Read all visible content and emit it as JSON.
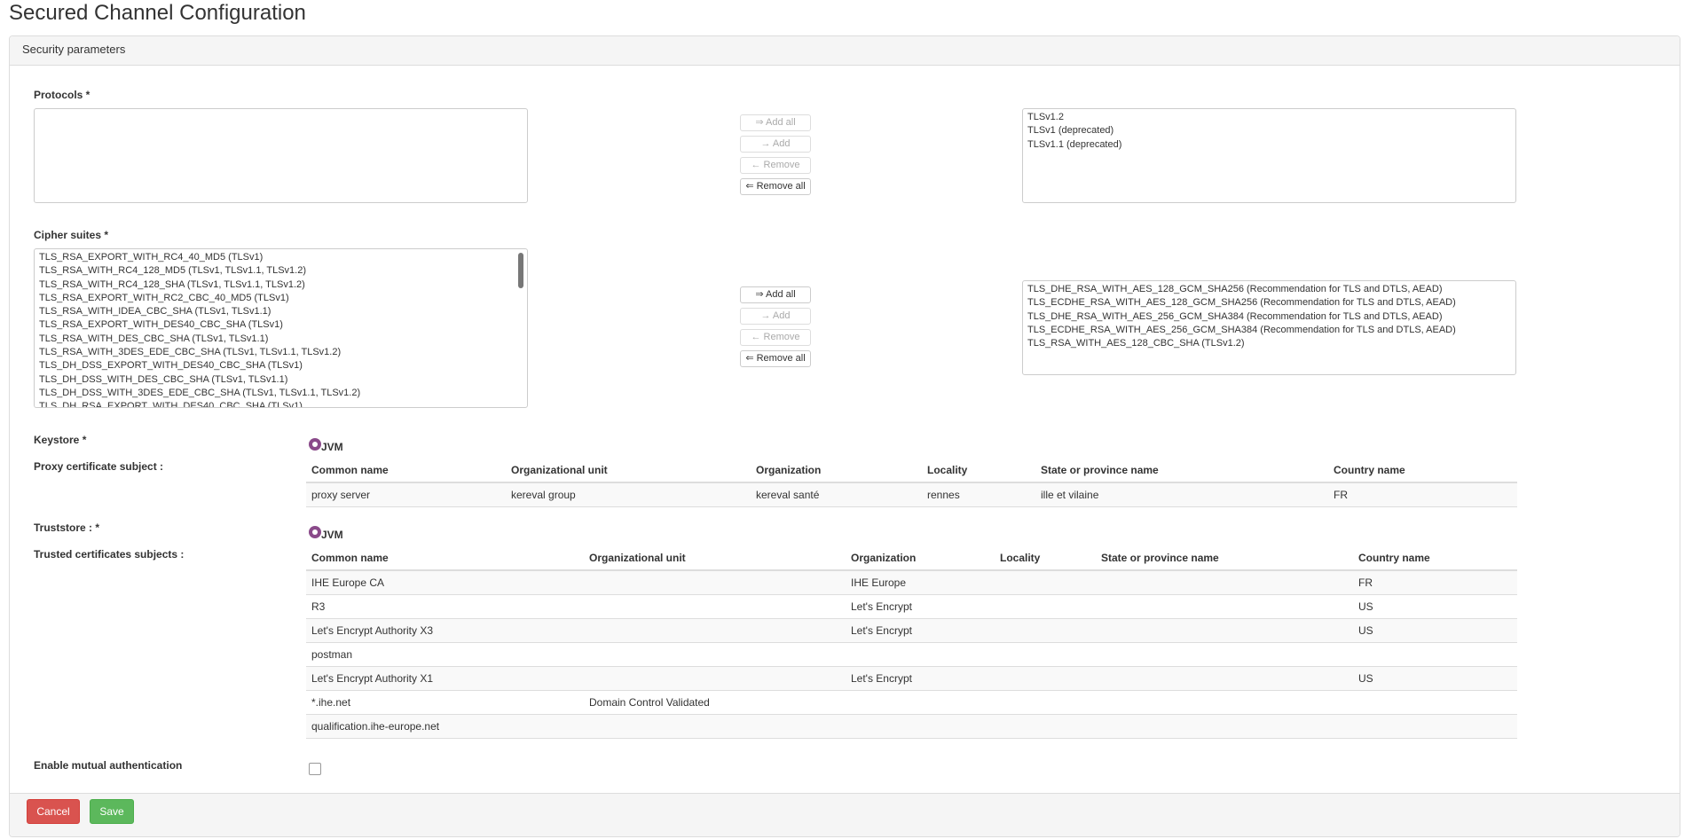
{
  "page": {
    "title": "Secured Channel Configuration"
  },
  "panel": {
    "heading": "Security parameters"
  },
  "protocols": {
    "label": "Protocols *",
    "available": [],
    "selected": [
      "TLSv1.2",
      "TLSv1 (deprecated)",
      "TLSv1.1 (deprecated)"
    ],
    "buttons": {
      "add_all": "⇒ Add all",
      "add": "→ Add",
      "remove": "← Remove",
      "remove_all": "⇐ Remove all"
    }
  },
  "cipher_suites": {
    "label": "Cipher suites *",
    "available": [
      "TLS_RSA_EXPORT_WITH_RC4_40_MD5 (TLSv1)",
      "TLS_RSA_WITH_RC4_128_MD5 (TLSv1, TLSv1.1, TLSv1.2)",
      "TLS_RSA_WITH_RC4_128_SHA (TLSv1, TLSv1.1, TLSv1.2)",
      "TLS_RSA_EXPORT_WITH_RC2_CBC_40_MD5 (TLSv1)",
      "TLS_RSA_WITH_IDEA_CBC_SHA (TLSv1, TLSv1.1)",
      "TLS_RSA_EXPORT_WITH_DES40_CBC_SHA (TLSv1)",
      "TLS_RSA_WITH_DES_CBC_SHA (TLSv1, TLSv1.1)",
      "TLS_RSA_WITH_3DES_EDE_CBC_SHA (TLSv1, TLSv1.1, TLSv1.2)",
      "TLS_DH_DSS_EXPORT_WITH_DES40_CBC_SHA (TLSv1)",
      "TLS_DH_DSS_WITH_DES_CBC_SHA (TLSv1, TLSv1.1)",
      "TLS_DH_DSS_WITH_3DES_EDE_CBC_SHA (TLSv1, TLSv1.1, TLSv1.2)",
      "TLS_DH_RSA_EXPORT_WITH_DES40_CBC_SHA (TLSv1)"
    ],
    "selected": [
      "TLS_DHE_RSA_WITH_AES_128_GCM_SHA256 (Recommendation for TLS and DTLS, AEAD)",
      "TLS_ECDHE_RSA_WITH_AES_128_GCM_SHA256 (Recommendation for TLS and DTLS, AEAD)",
      "TLS_DHE_RSA_WITH_AES_256_GCM_SHA384 (Recommendation for TLS and DTLS, AEAD)",
      "TLS_ECDHE_RSA_WITH_AES_256_GCM_SHA384 (Recommendation for TLS and DTLS, AEAD)",
      "TLS_RSA_WITH_AES_128_CBC_SHA (TLSv1.2)"
    ],
    "buttons": {
      "add_all": "⇒ Add all",
      "add": "→ Add",
      "remove": "← Remove",
      "remove_all": "⇐ Remove all"
    }
  },
  "keystore": {
    "label": "Keystore *",
    "option": "JVM",
    "proxy_label": "Proxy certificate subject :",
    "columns": [
      "Common name",
      "Organizational unit",
      "Organization",
      "Locality",
      "State or province name",
      "Country name"
    ],
    "rows": [
      [
        "proxy server",
        "kereval group",
        "kereval santé",
        "rennes",
        "ille et vilaine",
        "FR"
      ]
    ]
  },
  "truststore": {
    "label": "Truststore : *",
    "option": "JVM",
    "trusted_label": "Trusted certificates subjects :",
    "columns": [
      "Common name",
      "Organizational unit",
      "Organization",
      "Locality",
      "State or province name",
      "Country name"
    ],
    "rows": [
      [
        "IHE Europe CA",
        "",
        "IHE Europe",
        "",
        "",
        "FR"
      ],
      [
        "R3",
        "",
        "Let's Encrypt",
        "",
        "",
        "US"
      ],
      [
        "Let's Encrypt Authority X3",
        "",
        "Let's Encrypt",
        "",
        "",
        "US"
      ],
      [
        "postman",
        "",
        "",
        "",
        "",
        ""
      ],
      [
        "Let's Encrypt Authority X1",
        "",
        "Let's Encrypt",
        "",
        "",
        "US"
      ],
      [
        "*.ihe.net",
        "Domain Control Validated",
        "",
        "",
        "",
        ""
      ],
      [
        "qualification.ihe-europe.net",
        "",
        "",
        "",
        "",
        ""
      ]
    ]
  },
  "mutual_auth": {
    "label": "Enable mutual authentication",
    "checked": false
  },
  "footer": {
    "cancel": "Cancel",
    "save": "Save"
  },
  "colors": {
    "danger": "#d9534f",
    "success": "#5cb85c",
    "radio": "#8a4a8a"
  }
}
